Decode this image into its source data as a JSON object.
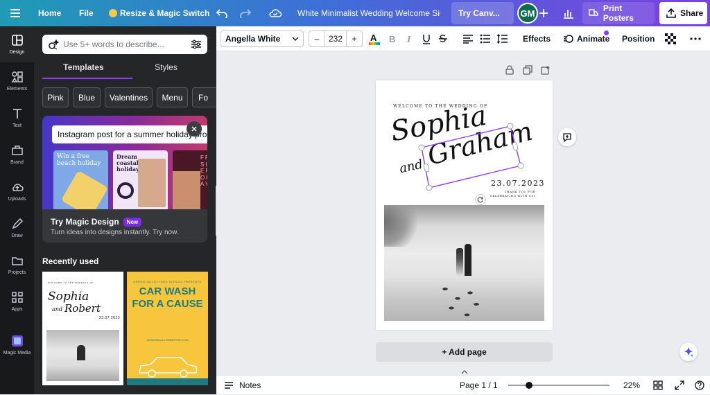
{
  "topbar": {
    "home": "Home",
    "file": "File",
    "resize": "Resize & Magic Switch",
    "title": "White Minimalist Wedding Welcome Sig...",
    "try_canva": "Try Canv...",
    "avatar": "GM",
    "print": "Print Posters",
    "share": "Share"
  },
  "rail": [
    {
      "label": "Design",
      "icon": "design-icon"
    },
    {
      "label": "Elements",
      "icon": "elements-icon"
    },
    {
      "label": "Text",
      "icon": "text-icon"
    },
    {
      "label": "Brand",
      "icon": "brand-icon"
    },
    {
      "label": "Uploads",
      "icon": "uploads-icon"
    },
    {
      "label": "Draw",
      "icon": "draw-icon"
    },
    {
      "label": "Projects",
      "icon": "projects-icon"
    },
    {
      "label": "Apps",
      "icon": "apps-icon"
    },
    {
      "label": "Magic Media",
      "icon": "magic-media-icon"
    }
  ],
  "panel": {
    "search_placeholder": "Use 5+ words to describe...",
    "tabs": [
      "Templates",
      "Styles"
    ],
    "chips": [
      "Pink",
      "Blue",
      "Valentines",
      "Menu",
      "Fo"
    ],
    "promo": {
      "prompt": "Instagram post for a summer holiday promo",
      "card1": "Win a free beach holiday",
      "card2": "Dream coastal holiday",
      "card3": "FREE SUMMER HOLIDAY",
      "title": "Try Magic Design",
      "badge": "New",
      "subtitle": "Turn ideas into designs instantly. Try now."
    },
    "recent_label": "Recently used",
    "recent1": {
      "header": "WELCOME TO THE WEDDING OF",
      "name1": "Sophia",
      "and": "and",
      "name2": "Robert",
      "date": "23.07.2023"
    },
    "recent2": {
      "top": "GREEN VALLEY HIGH SCHOOL PRESENTS",
      "title1": "CAR WASH",
      "title2": "FOR A CAUSE",
      "website": "WWW.REALLYGREATSITE.COM"
    }
  },
  "toolbar": {
    "font": "Angella White",
    "minus": "–",
    "size": "232",
    "plus": "+",
    "effects": "Effects",
    "animate": "Animate",
    "position": "Position"
  },
  "page": {
    "header": "WELCOME TO THE WEDDING OF",
    "name1": "Sophia",
    "and": "and",
    "name2": "Graham",
    "date": "23.07.2023",
    "thanks1": "THANK YOU FOR",
    "thanks2": "CELEBRATING WITH US!"
  },
  "add_page": "+ Add page",
  "bottom": {
    "notes": "Notes",
    "page": "Page 1 / 1",
    "zoom": "22%",
    "zoom_level": 0.22
  },
  "colors": {
    "accent": "#8b3dff",
    "sidebar": "#18191b",
    "panel": "#252627"
  }
}
